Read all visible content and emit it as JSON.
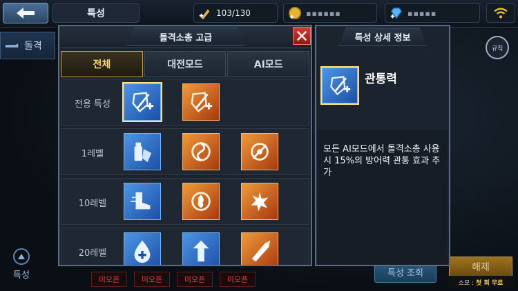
{
  "header": {
    "title": "특성",
    "ammo": "103/130",
    "gold_masked": "▪▪▪▪▪▪",
    "gems_masked": "▪▪▪▪▪"
  },
  "left_tab": {
    "label": "돌격"
  },
  "left_bottom": {
    "label": "특성"
  },
  "help": {
    "label": "규칙"
  },
  "dialog": {
    "title": "돌격소총 고급",
    "tabs": [
      {
        "label": "전체",
        "active": true
      },
      {
        "label": "대전모드",
        "active": false
      },
      {
        "label": "AI모드",
        "active": false
      }
    ],
    "rows": [
      {
        "label": "전용 특성"
      },
      {
        "label": "1레벨"
      },
      {
        "label": "10레벨"
      },
      {
        "label": "20레벨"
      }
    ]
  },
  "detail": {
    "header": "특성 상세 정보",
    "name": "관통력",
    "description": "모든 AI모드에서 돌격소총 사용 시 15%의 방어력 관통 효과 추가"
  },
  "bottom": {
    "tags": [
      "미오픈",
      "미오픈",
      "미오픈",
      "미오픈"
    ],
    "reset_label": "특성 조회",
    "release_label": "해제",
    "cost_prefix": "소모 :",
    "cost_value": "첫 회 무료"
  },
  "colors": {
    "accent": "#ffd866",
    "blue_icon": "#2f72c9",
    "orange_icon": "#d9661f",
    "close": "#c0352a"
  }
}
